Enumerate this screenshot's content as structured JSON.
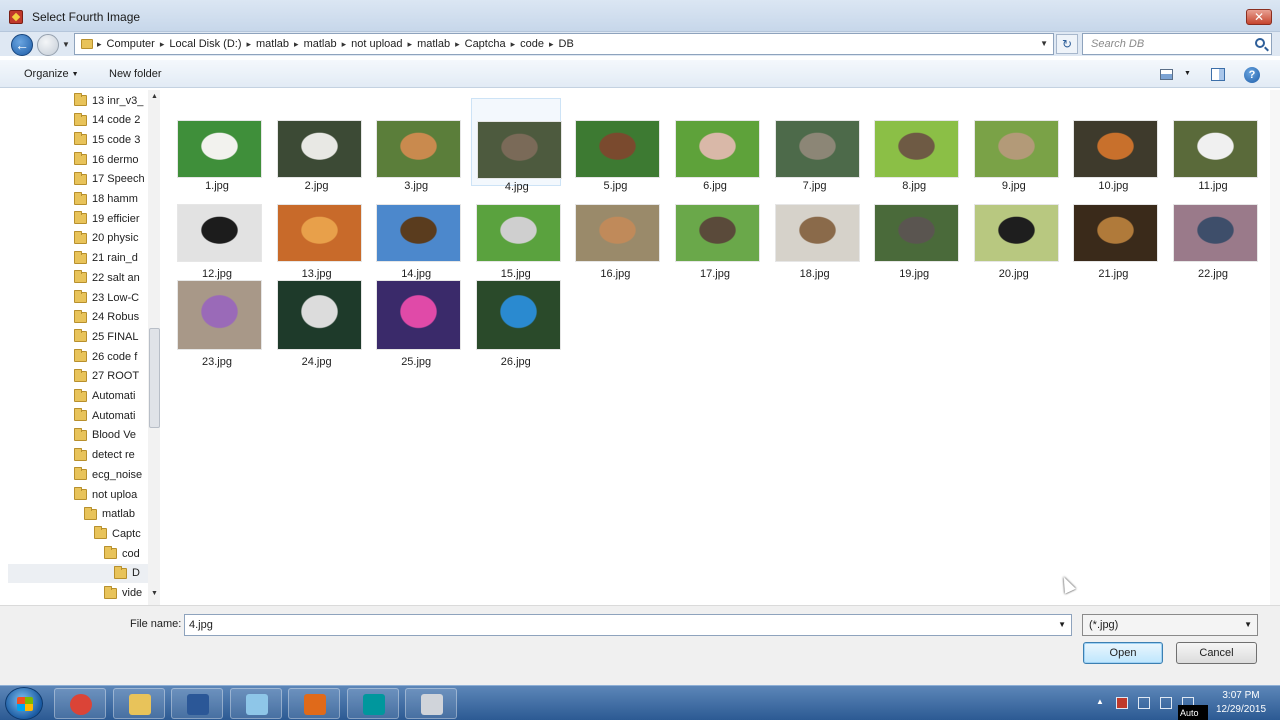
{
  "window": {
    "title": "Select Fourth Image",
    "close_glyph": "✕"
  },
  "nav": {
    "crumbs": [
      "Computer",
      "Local Disk (D:)",
      "matlab",
      "matlab",
      "not upload",
      "matlab",
      "Captcha",
      "code",
      "DB"
    ],
    "search_placeholder": "Search DB"
  },
  "toolbar": {
    "organize": "Organize",
    "new_folder": "New folder",
    "help": "?"
  },
  "sidebar": {
    "items": [
      {
        "label": "13 inr_v3_",
        "indent": 0
      },
      {
        "label": "14 code 2",
        "indent": 0
      },
      {
        "label": "15 code 3",
        "indent": 0
      },
      {
        "label": "16 dermo",
        "indent": 0
      },
      {
        "label": "17 Speech",
        "indent": 0
      },
      {
        "label": "18 hamm",
        "indent": 0
      },
      {
        "label": "19 efficier",
        "indent": 0
      },
      {
        "label": "20 physic",
        "indent": 0
      },
      {
        "label": "21 rain_d",
        "indent": 0
      },
      {
        "label": "22 salt an",
        "indent": 0
      },
      {
        "label": "23 Low-C",
        "indent": 0
      },
      {
        "label": "24 Robus",
        "indent": 0
      },
      {
        "label": "25 FINAL",
        "indent": 0
      },
      {
        "label": "26 code f",
        "indent": 0
      },
      {
        "label": "27 ROOT",
        "indent": 0
      },
      {
        "label": "Automati",
        "indent": 0
      },
      {
        "label": "Automati",
        "indent": 0
      },
      {
        "label": "Blood Ve",
        "indent": 0
      },
      {
        "label": "detect re",
        "indent": 0
      },
      {
        "label": "ecg_noise",
        "indent": 0
      },
      {
        "label": "not uploa",
        "indent": 0
      },
      {
        "label": "matlab",
        "indent": 1
      },
      {
        "label": "Captc",
        "indent": 2
      },
      {
        "label": "cod",
        "indent": 3
      },
      {
        "label": "D",
        "indent": 4
      },
      {
        "label": "vide",
        "indent": 3
      }
    ],
    "selected_label": "D"
  },
  "files": [
    {
      "label": "1.jpg",
      "c1": "#3f8f3a",
      "c2": "#f2f2ee"
    },
    {
      "label": "2.jpg",
      "c1": "#3c4a35",
      "c2": "#e8e8e4"
    },
    {
      "label": "3.jpg",
      "c1": "#5b7e3a",
      "c2": "#c98a4e"
    },
    {
      "label": "4.jpg",
      "c1": "#4d5a3e",
      "c2": "#7a6a58"
    },
    {
      "label": "5.jpg",
      "c1": "#3d7a32",
      "c2": "#7a4a2e"
    },
    {
      "label": "6.jpg",
      "c1": "#5ea23a",
      "c2": "#d9b8a8"
    },
    {
      "label": "7.jpg",
      "c1": "#4d6a4a",
      "c2": "#8c8676"
    },
    {
      "label": "8.jpg",
      "c1": "#8bbf46",
      "c2": "#6e5a44"
    },
    {
      "label": "9.jpg",
      "c1": "#7aa247",
      "c2": "#b39a78"
    },
    {
      "label": "10.jpg",
      "c1": "#3e3a2c",
      "c2": "#c8702c"
    },
    {
      "label": "11.jpg",
      "c1": "#5a6a3a",
      "c2": "#f0f0f0"
    },
    {
      "label": "12.jpg",
      "c1": "#e2e2e2",
      "c2": "#1c1c1c"
    },
    {
      "label": "13.jpg",
      "c1": "#c86a2a",
      "c2": "#e8a04a"
    },
    {
      "label": "14.jpg",
      "c1": "#4c88cc",
      "c2": "#5a3c1e"
    },
    {
      "label": "15.jpg",
      "c1": "#5aa23e",
      "c2": "#cfcfcf"
    },
    {
      "label": "16.jpg",
      "c1": "#9a8a6a",
      "c2": "#c08a5a"
    },
    {
      "label": "17.jpg",
      "c1": "#6aa84a",
      "c2": "#5a4a3a"
    },
    {
      "label": "18.jpg",
      "c1": "#d6d2ca",
      "c2": "#8a6a4a"
    },
    {
      "label": "19.jpg",
      "c1": "#4a6a3a",
      "c2": "#5a5550"
    },
    {
      "label": "20.jpg",
      "c1": "#b8c880",
      "c2": "#1e1e1e"
    },
    {
      "label": "21.jpg",
      "c1": "#3a2a1a",
      "c2": "#b07a3a"
    },
    {
      "label": "22.jpg",
      "c1": "#9a7a8a",
      "c2": "#3e4e6a"
    },
    {
      "label": "23.jpg",
      "c1": "#a89888",
      "c2": "#9a6ab8"
    },
    {
      "label": "24.jpg",
      "c1": "#1e3a2a",
      "c2": "#dcdcdc"
    },
    {
      "label": "25.jpg",
      "c1": "#3a2a6a",
      "c2": "#e04aa8"
    },
    {
      "label": "26.jpg",
      "c1": "#2a4a2a",
      "c2": "#2a8ad0"
    }
  ],
  "selected_file": "4.jpg",
  "footer": {
    "file_name_label": "File name:",
    "file_name_value": "4.jpg",
    "file_type": "(*.jpg)",
    "open_label": "Open",
    "cancel_label": "Cancel"
  },
  "taskbar": {
    "apps": [
      {
        "name": "chrome-icon",
        "color": "#db4437"
      },
      {
        "name": "file-explorer-icon",
        "color": "#e8c35a"
      },
      {
        "name": "word-icon",
        "color": "#2b5797"
      },
      {
        "name": "notepad-icon",
        "color": "#8ec6e8"
      },
      {
        "name": "matlab-icon",
        "color": "#e06a1a"
      },
      {
        "name": "arduino-icon",
        "color": "#00979d"
      },
      {
        "name": "window-icon",
        "color": "#d0d4da"
      }
    ],
    "time": "3:07 PM",
    "date": "12/29/2015",
    "tooltip": "Auto"
  }
}
